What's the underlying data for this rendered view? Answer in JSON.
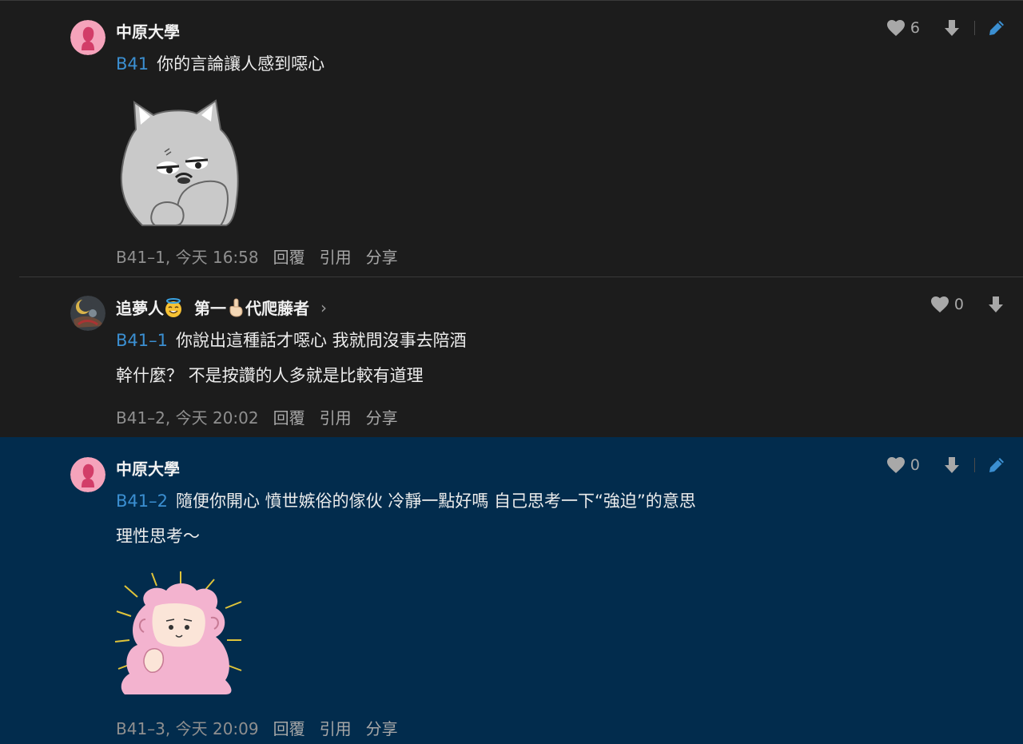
{
  "comments": [
    {
      "author": "中原大學",
      "floor_ref": "B41",
      "lines": [
        "你的言論讓人感到噁心"
      ],
      "likes": "6",
      "meta_id": "B41–1, 今天 16:58",
      "actions": [
        "回覆",
        "引用",
        "分享"
      ]
    },
    {
      "author": "追夢人",
      "author_tag": "第一",
      "author_tag2": "代爬藤者",
      "floor_ref": "B41–1",
      "lines": [
        "你說出這種話才噁心  我就問沒事去陪酒",
        "幹什麼？ 不是按讚的人多就是比較有道理"
      ],
      "likes": "0",
      "meta_id": "B41–2, 今天 20:02",
      "actions": [
        "回覆",
        "引用",
        "分享"
      ]
    },
    {
      "author": "中原大學",
      "floor_ref": "B41–2",
      "lines": [
        "隨便你開心 憤世嫉俗的傢伙 冷靜一點好嗎 自己思考一下“強迫”的意思",
        "理性思考～"
      ],
      "likes": "0",
      "meta_id": "B41–3, 今天 20:09",
      "actions": [
        "回覆",
        "引用",
        "分享"
      ]
    }
  ],
  "colors": {
    "floor_link": "#3b8fd1",
    "edit_icon": "#3b8fd1",
    "highlight_bg": "#022c4d",
    "bg": "#1c1c1c"
  }
}
